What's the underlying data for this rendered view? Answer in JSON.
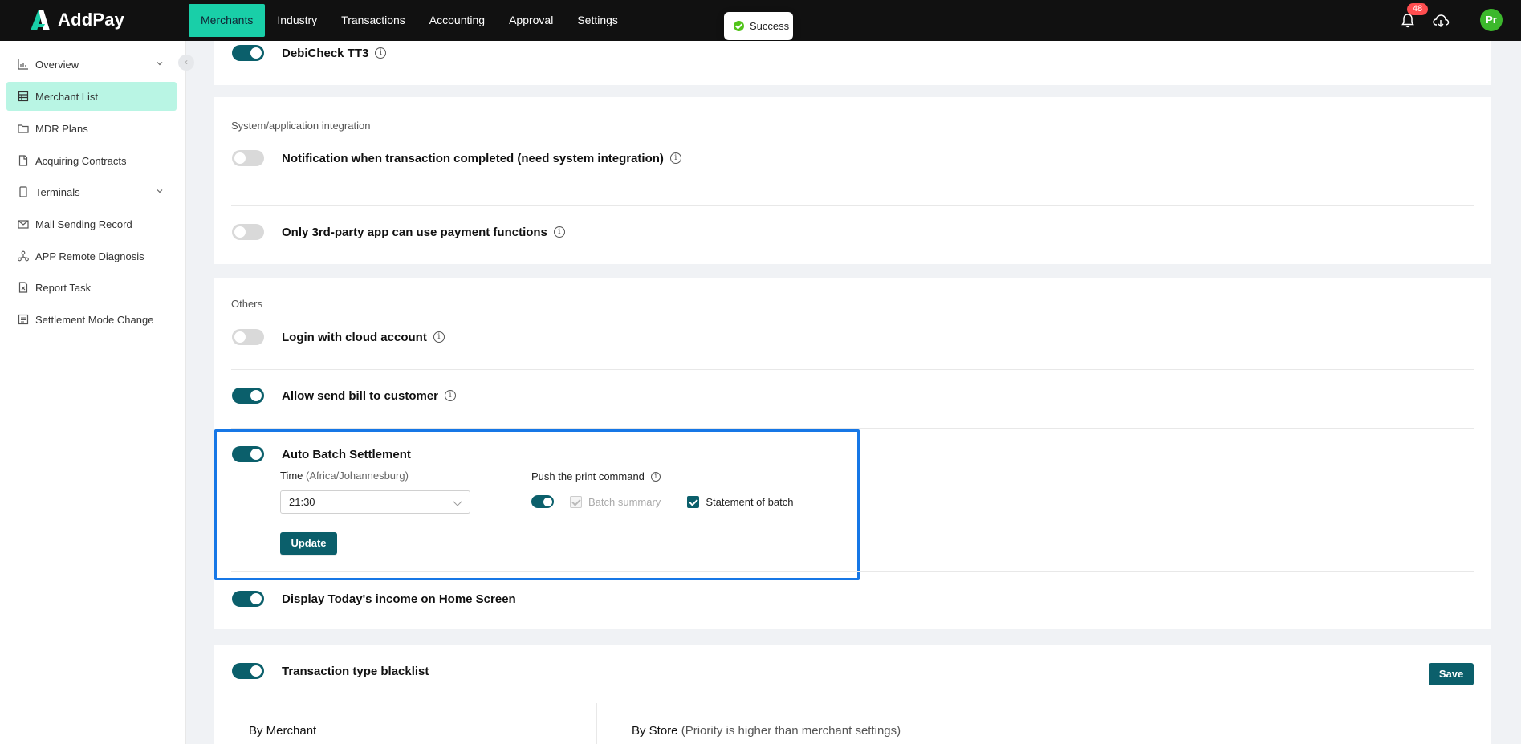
{
  "header": {
    "brand": "AddPay",
    "nav": [
      {
        "label": "Merchants",
        "active": true
      },
      {
        "label": "Industry",
        "active": false
      },
      {
        "label": "Transactions",
        "active": false
      },
      {
        "label": "Accounting",
        "active": false
      },
      {
        "label": "Approval",
        "active": false
      },
      {
        "label": "Settings",
        "active": false
      }
    ],
    "toast": "Success",
    "notification_count": "48",
    "avatar_initials": "Pr",
    "accent_color": "#19cfa8"
  },
  "sidebar": {
    "items": [
      {
        "label": "Overview",
        "icon": "chart-icon",
        "has_chevron": true
      },
      {
        "label": "Merchant List",
        "icon": "table-icon",
        "active": true
      },
      {
        "label": "MDR Plans",
        "icon": "folder-icon"
      },
      {
        "label": "Acquiring Contracts",
        "icon": "document-icon"
      },
      {
        "label": "Terminals",
        "icon": "device-icon",
        "has_chevron": true
      },
      {
        "label": "Mail Sending Record",
        "icon": "mail-icon"
      },
      {
        "label": "APP Remote Diagnosis",
        "icon": "network-icon"
      },
      {
        "label": "Report Task",
        "icon": "report-icon"
      },
      {
        "label": "Settlement Mode Change",
        "icon": "settlement-icon"
      }
    ],
    "collapse_glyph": "‹"
  },
  "settings": {
    "debicheck": {
      "label": "DebiCheck TT3",
      "on": true
    },
    "system_integration": {
      "title": "System/application integration",
      "notification": {
        "label": "Notification when transaction completed (need system integration)",
        "on": false
      },
      "third_party": {
        "label": "Only 3rd-party app can use payment functions",
        "on": false
      }
    },
    "others": {
      "title": "Others",
      "cloud_login": {
        "label": "Login with cloud account",
        "on": false
      },
      "send_bill": {
        "label": "Allow send bill to customer",
        "on": true
      },
      "auto_batch": {
        "label": "Auto Batch Settlement",
        "on": true,
        "time_label": "Time",
        "timezone": "(Africa/Johannesburg)",
        "time_value": "21:30",
        "update_label": "Update",
        "push_label": "Push the print command",
        "push_on": true,
        "batch_summary": "Batch summary",
        "statement_of_batch": "Statement of batch"
      },
      "todays_income": {
        "label": "Display Today's income on Home Screen",
        "on": true
      }
    },
    "blacklist": {
      "label": "Transaction type blacklist",
      "on": true,
      "save_label": "Save",
      "by_merchant": "By Merchant",
      "by_store": "By Store",
      "by_store_note": "(Priority is higher than merchant settings)"
    }
  },
  "colors": {
    "toggle_on": "#0b5f6b",
    "highlight_border": "#1677e6",
    "success": "#52c41a"
  }
}
